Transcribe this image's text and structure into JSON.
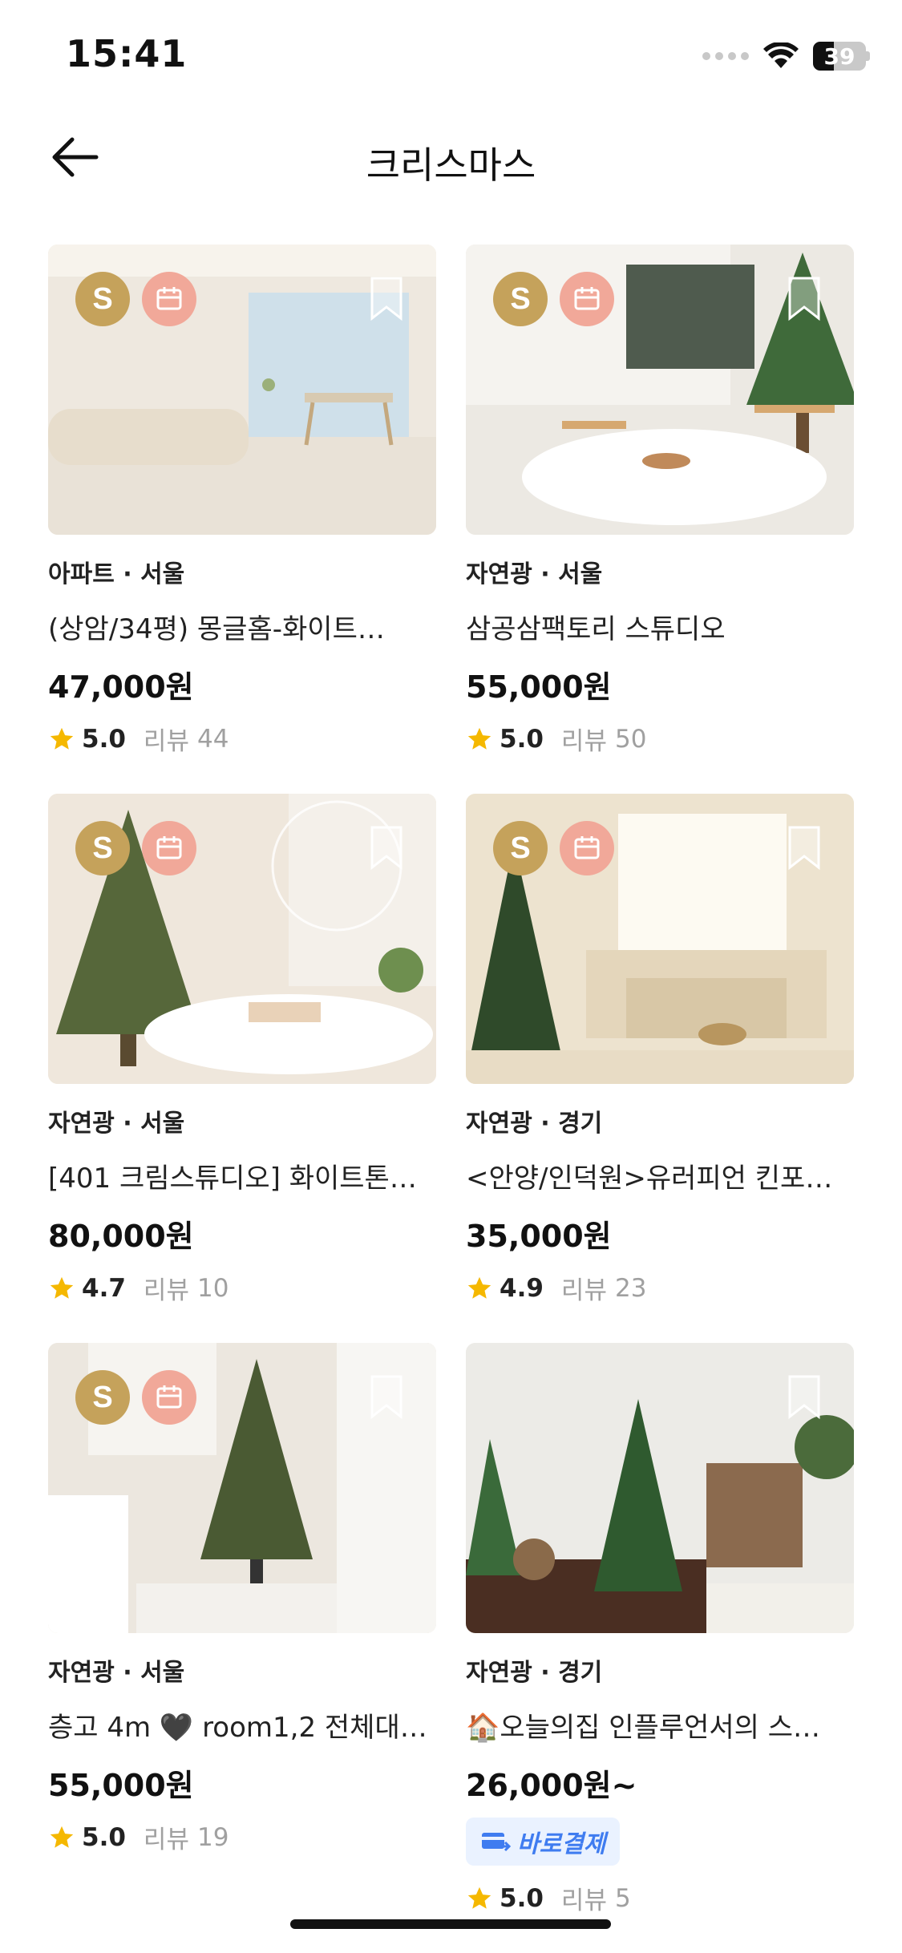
{
  "status_bar": {
    "time": "15:41",
    "battery": "39"
  },
  "header": {
    "title": "크리스마스"
  },
  "listings": [
    {
      "meta": "아파트 · 서울",
      "title": "(상암/34평) 몽글홈-화이트…",
      "price": "47,000원",
      "rating": "5.0",
      "review_label": "리뷰",
      "review_count": "44",
      "badge_s": "S",
      "instant_pay": ""
    },
    {
      "meta": "자연광 · 서울",
      "title": "삼공삼팩토리 스튜디오",
      "price": "55,000원",
      "rating": "5.0",
      "review_label": "리뷰",
      "review_count": "50",
      "badge_s": "S",
      "instant_pay": ""
    },
    {
      "meta": "자연광 · 서울",
      "title": "[401 크림스튜디오] 화이트톤…",
      "price": "80,000원",
      "rating": "4.7",
      "review_label": "리뷰",
      "review_count": "10",
      "badge_s": "S",
      "instant_pay": ""
    },
    {
      "meta": "자연광 · 경기",
      "title": "<안양/인덕원>유러피언 킨포…",
      "price": "35,000원",
      "rating": "4.9",
      "review_label": "리뷰",
      "review_count": "23",
      "badge_s": "S",
      "instant_pay": ""
    },
    {
      "meta": "자연광 · 서울",
      "title": "층고 4m 🖤 room1,2 전체대…",
      "price": "55,000원",
      "rating": "5.0",
      "review_label": "리뷰",
      "review_count": "19",
      "badge_s": "S",
      "instant_pay": ""
    },
    {
      "meta": "자연광 · 경기",
      "title": "🏠오늘의집 인플루언서의 스…",
      "price": "26,000원~",
      "rating": "5.0",
      "review_label": "리뷰",
      "review_count": "5",
      "badge_s": "",
      "instant_pay": "바로결제"
    }
  ],
  "colors": {
    "accent_gold": "#c5a25b",
    "calendar_badge": "#f1a899",
    "star": "#f5b800",
    "pay_blue": "#3f7cf0"
  },
  "icons": {
    "back": "arrow-left-icon",
    "bookmark": "bookmark-icon",
    "calendar": "calendar-icon",
    "star": "star-icon",
    "card": "card-icon"
  }
}
